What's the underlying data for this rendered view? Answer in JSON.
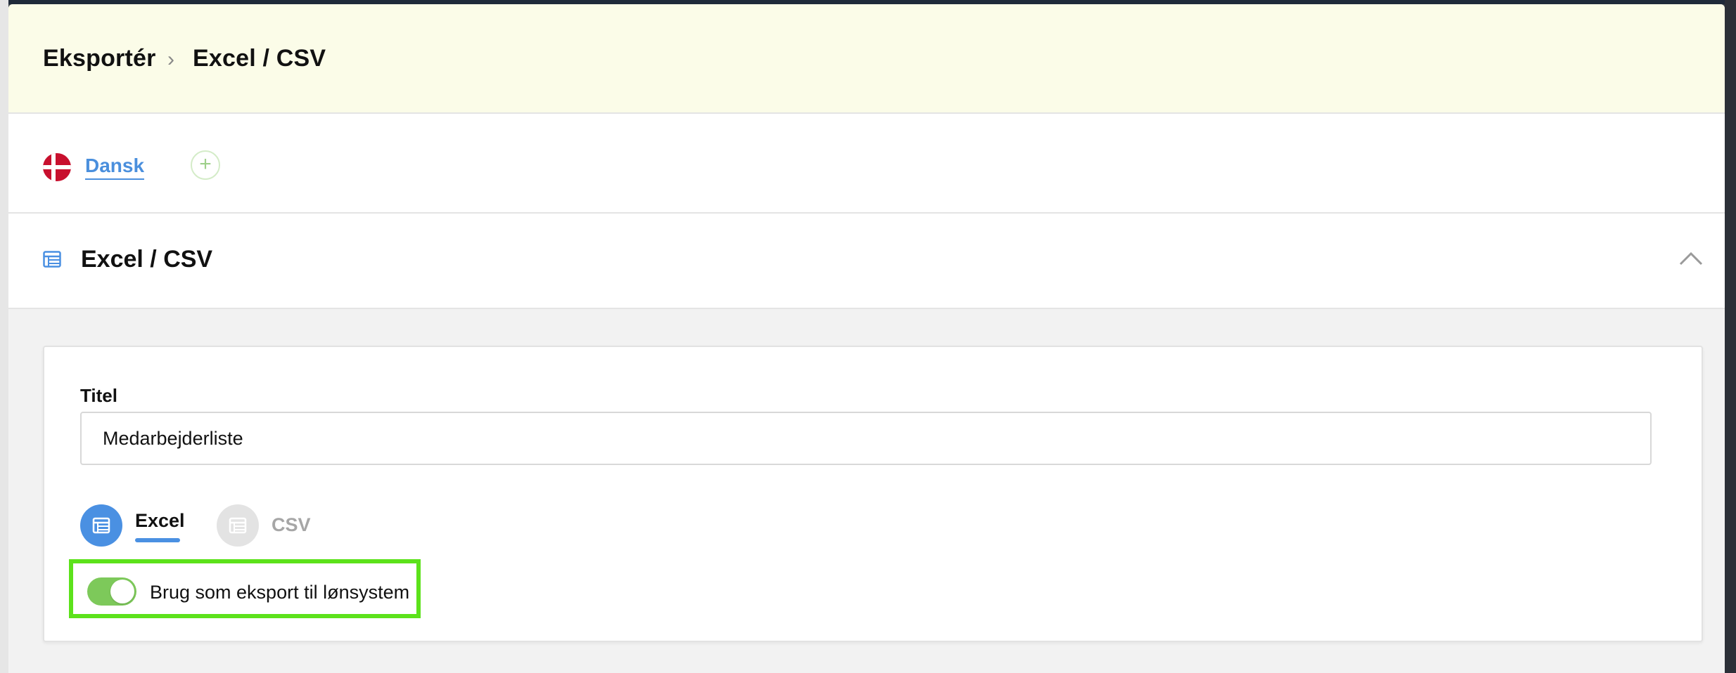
{
  "breadcrumb": {
    "root": "Eksportér",
    "separator": "›",
    "current": "Excel / CSV"
  },
  "language": {
    "flag_icon": "denmark-flag-icon",
    "label": "Dansk",
    "add_icon": "plus-icon",
    "add_symbol": "+"
  },
  "section": {
    "icon": "table-icon",
    "title": "Excel / CSV",
    "collapse_icon": "chevron-up-icon"
  },
  "form": {
    "title_label": "Titel",
    "title_value": "Medarbejderliste",
    "formats": [
      {
        "label": "Excel",
        "selected": true,
        "icon": "table-icon"
      },
      {
        "label": "CSV",
        "selected": false,
        "icon": "table-icon"
      }
    ],
    "payroll_toggle": {
      "label": "Brug som eksport til lønsystem",
      "on": true
    }
  },
  "colors": {
    "header_bg": "#fbfce8",
    "accent": "#4a90e2",
    "toggle_on": "#7dc95a",
    "highlight": "#5ce21b",
    "flag_red": "#c8102e"
  }
}
